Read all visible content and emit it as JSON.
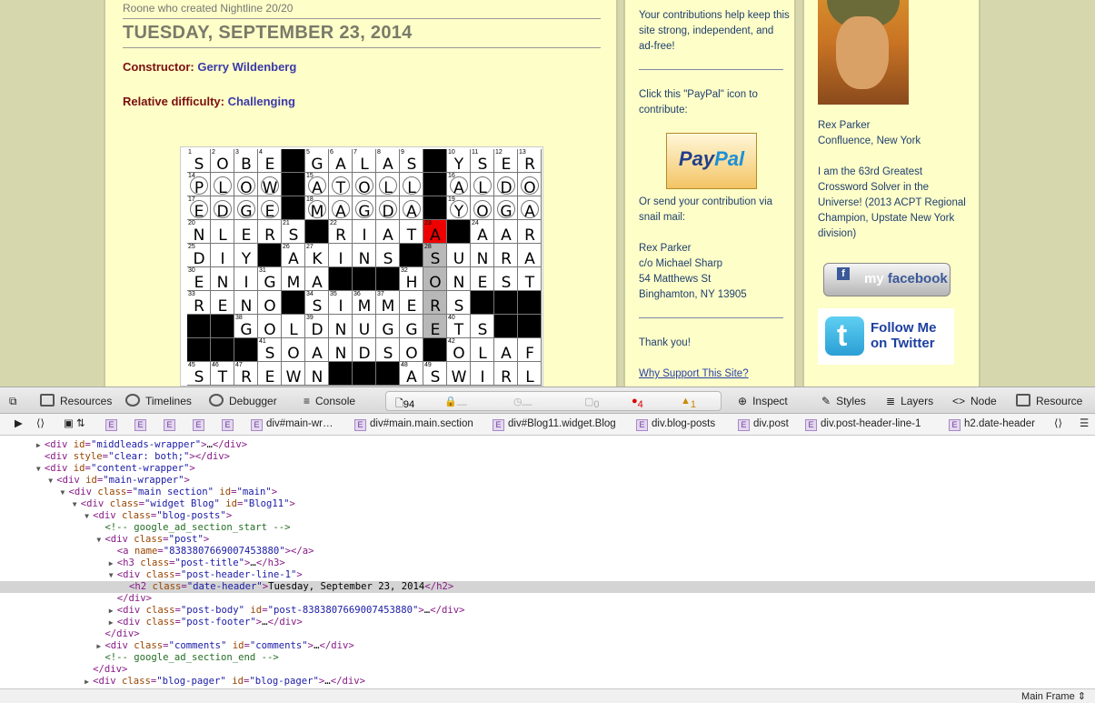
{
  "blog": {
    "prev_post_tail": "Roone who created Nightline 20/20",
    "date_header": "TUESDAY, SEPTEMBER 23, 2014",
    "constructor_label": "Constructor:",
    "constructor_name": "Gerry Wildenberg",
    "difficulty_label": "Relative difficulty:",
    "difficulty_value": "Challenging"
  },
  "crossword": {
    "rows": [
      [
        "S",
        "O",
        "B",
        "E",
        "#",
        "G",
        "A",
        "L",
        "A",
        "S",
        "#",
        "Y",
        "S",
        "E",
        "R"
      ],
      [
        "P",
        "L",
        "O",
        "W",
        "#",
        "A",
        "T",
        "O",
        "L",
        "L",
        "#",
        "A",
        "L",
        "D",
        "O"
      ],
      [
        "E",
        "D",
        "G",
        "E",
        "#",
        "M",
        "A",
        "G",
        "D",
        "A",
        "#",
        "Y",
        "O",
        "G",
        "A"
      ],
      [
        "N",
        "L",
        "E",
        "R",
        "S",
        "#",
        "R",
        "I",
        "A",
        "T",
        "A",
        "#",
        "A",
        "A",
        "R"
      ],
      [
        "D",
        "I",
        "Y",
        "#",
        "A",
        "K",
        "I",
        "N",
        "S",
        "#",
        "S",
        "U",
        "N",
        "R",
        "A"
      ],
      [
        "E",
        "N",
        "I",
        "G",
        "M",
        "A",
        "#",
        "#",
        "#",
        "H",
        "O",
        "N",
        "E",
        "S",
        "T"
      ],
      [
        "R",
        "E",
        "N",
        "O",
        "#",
        "S",
        "I",
        "M",
        "M",
        "E",
        "R",
        "S",
        "#",
        "#",
        "#"
      ],
      [
        "#",
        "#",
        "G",
        "O",
        "L",
        "D",
        "N",
        "U",
        "G",
        "G",
        "E",
        "T",
        "S",
        "#",
        "#"
      ],
      [
        "#",
        "#",
        "#",
        "S",
        "O",
        "A",
        "N",
        "D",
        "S",
        "O",
        "#",
        "O",
        "L",
        "A",
        "F"
      ],
      [
        "S",
        "T",
        "R",
        "E",
        "W",
        "N",
        "#",
        "#",
        "#",
        "A",
        "S",
        "W",
        "I",
        "R",
        "L"
      ]
    ],
    "numbers": [
      [
        1,
        2,
        3,
        4,
        null,
        5,
        6,
        7,
        8,
        9,
        null,
        10,
        11,
        12,
        13
      ],
      [
        14,
        null,
        null,
        null,
        null,
        15,
        null,
        null,
        null,
        null,
        null,
        16,
        null,
        null,
        null
      ],
      [
        17,
        null,
        null,
        null,
        null,
        18,
        null,
        null,
        null,
        null,
        null,
        19,
        null,
        null,
        null
      ],
      [
        20,
        null,
        null,
        null,
        21,
        null,
        22,
        null,
        null,
        null,
        23,
        null,
        24,
        null,
        null
      ],
      [
        25,
        null,
        null,
        null,
        26,
        27,
        null,
        null,
        null,
        null,
        28,
        null,
        null,
        null,
        null
      ],
      [
        30,
        null,
        null,
        31,
        null,
        null,
        null,
        null,
        null,
        32,
        null,
        null,
        null,
        null,
        null
      ],
      [
        33,
        null,
        null,
        null,
        null,
        34,
        35,
        36,
        37,
        null,
        null,
        null,
        null,
        null,
        null
      ],
      [
        null,
        null,
        38,
        null,
        null,
        39,
        null,
        null,
        null,
        null,
        null,
        40,
        null,
        null,
        null
      ],
      [
        null,
        null,
        null,
        41,
        null,
        null,
        null,
        null,
        null,
        null,
        null,
        42,
        null,
        null,
        null
      ],
      [
        45,
        46,
        47,
        null,
        null,
        null,
        null,
        null,
        null,
        48,
        49,
        null,
        null,
        null,
        null
      ]
    ],
    "circled": [
      [
        1,
        0
      ],
      [
        1,
        1
      ],
      [
        1,
        2
      ],
      [
        1,
        3
      ],
      [
        1,
        5
      ],
      [
        1,
        6
      ],
      [
        1,
        7
      ],
      [
        1,
        8
      ],
      [
        1,
        9
      ],
      [
        1,
        11
      ],
      [
        1,
        12
      ],
      [
        1,
        13
      ],
      [
        1,
        14
      ],
      [
        2,
        0
      ],
      [
        2,
        1
      ],
      [
        2,
        2
      ],
      [
        2,
        3
      ],
      [
        2,
        5
      ],
      [
        2,
        6
      ],
      [
        2,
        7
      ],
      [
        2,
        8
      ],
      [
        2,
        9
      ],
      [
        2,
        11
      ],
      [
        2,
        12
      ],
      [
        2,
        13
      ],
      [
        2,
        14
      ]
    ],
    "highlight_red": [
      [
        3,
        10
      ]
    ],
    "highlight_gray": [
      [
        4,
        10
      ],
      [
        5,
        10
      ],
      [
        6,
        10
      ],
      [
        7,
        10
      ]
    ]
  },
  "sidebar_mid": {
    "contrib_text": "Your contributions help keep this site strong, independent, and ad-free!",
    "paypal_prompt": "Click this \"PayPal\" icon to contribute:",
    "paypal_pay": "Pay",
    "paypal_pal": "Pal",
    "snail_text": "Or send your contribution via snail mail:",
    "addr_name": "Rex Parker",
    "addr_co": "c/o Michael Sharp",
    "addr_street": "54 Matthews St",
    "addr_city": "Binghamton, NY 13905",
    "thanks": "Thank you!",
    "why_link": "Why Support This Site?"
  },
  "sidebar_right": {
    "name": "Rex Parker",
    "location": "Confluence, New York",
    "bio": "I am the 63rd Greatest Crossword Solver in the Universe! (2013 ACPT Regional Champion, Upstate New York division)",
    "facebook_my": "my",
    "facebook_word": "facebook",
    "twitter_line1": "Follow Me",
    "twitter_line2": "on Twitter"
  },
  "devtools": {
    "tabs": {
      "resources": "Resources",
      "timelines": "Timelines",
      "debugger": "Debugger",
      "console": "Console",
      "inspect": "Inspect",
      "styles": "Styles",
      "layers": "Layers",
      "node": "Node",
      "resource": "Resource"
    },
    "status": {
      "resources_count": "94",
      "network": "—",
      "time": "—",
      "logs": "0",
      "errors": "4",
      "warnings": "1"
    },
    "crumbs": [
      "div#main-wr…",
      "div#main.main.section",
      "div#Blog11.widget.Blog",
      "div.blog-posts",
      "div.post",
      "div.post-header-line-1",
      "h2.date-header"
    ],
    "crumb_e": "E",
    "frame": "Main Frame",
    "dom_lines": [
      {
        "indent": 3,
        "tri": "▶",
        "parts": [
          [
            "tg",
            "<div "
          ],
          [
            "an",
            "id"
          ],
          [
            "tg",
            "="
          ],
          [
            "av",
            "\"middleads-wrapper\""
          ],
          [
            "tg",
            ">"
          ],
          [
            "tx",
            "…"
          ],
          [
            "tg",
            "</div>"
          ]
        ]
      },
      {
        "indent": 3,
        "tri": "",
        "parts": [
          [
            "tg",
            "<div "
          ],
          [
            "an",
            "style"
          ],
          [
            "tg",
            "="
          ],
          [
            "av",
            "\"clear: both;\""
          ],
          [
            "tg",
            "></div>"
          ]
        ]
      },
      {
        "indent": 3,
        "tri": "▼",
        "parts": [
          [
            "tg",
            "<div "
          ],
          [
            "an",
            "id"
          ],
          [
            "tg",
            "="
          ],
          [
            "av",
            "\"content-wrapper\""
          ],
          [
            "tg",
            ">"
          ]
        ]
      },
      {
        "indent": 4,
        "tri": "▼",
        "parts": [
          [
            "tg",
            "<div "
          ],
          [
            "an",
            "id"
          ],
          [
            "tg",
            "="
          ],
          [
            "av",
            "\"main-wrapper\""
          ],
          [
            "tg",
            ">"
          ]
        ]
      },
      {
        "indent": 5,
        "tri": "▼",
        "parts": [
          [
            "tg",
            "<div "
          ],
          [
            "an",
            "class"
          ],
          [
            "tg",
            "="
          ],
          [
            "av",
            "\"main section\""
          ],
          [
            "tg",
            " "
          ],
          [
            "an",
            "id"
          ],
          [
            "tg",
            "="
          ],
          [
            "av",
            "\"main\""
          ],
          [
            "tg",
            ">"
          ]
        ]
      },
      {
        "indent": 6,
        "tri": "▼",
        "parts": [
          [
            "tg",
            "<div "
          ],
          [
            "an",
            "class"
          ],
          [
            "tg",
            "="
          ],
          [
            "av",
            "\"widget Blog\""
          ],
          [
            "tg",
            " "
          ],
          [
            "an",
            "id"
          ],
          [
            "tg",
            "="
          ],
          [
            "av",
            "\"Blog11\""
          ],
          [
            "tg",
            ">"
          ]
        ]
      },
      {
        "indent": 7,
        "tri": "▼",
        "parts": [
          [
            "tg",
            "<div "
          ],
          [
            "an",
            "class"
          ],
          [
            "tg",
            "="
          ],
          [
            "av",
            "\"blog-posts\""
          ],
          [
            "tg",
            ">"
          ]
        ]
      },
      {
        "indent": 8,
        "tri": "",
        "parts": [
          [
            "cm",
            "<!-- google_ad_section_start -->"
          ]
        ]
      },
      {
        "indent": 8,
        "tri": "▼",
        "parts": [
          [
            "tg",
            "<div "
          ],
          [
            "an",
            "class"
          ],
          [
            "tg",
            "="
          ],
          [
            "av",
            "\"post\""
          ],
          [
            "tg",
            ">"
          ]
        ]
      },
      {
        "indent": 9,
        "tri": "",
        "parts": [
          [
            "tg",
            "<a "
          ],
          [
            "an",
            "name"
          ],
          [
            "tg",
            "="
          ],
          [
            "av",
            "\"8383807669007453880\""
          ],
          [
            "tg",
            "></a>"
          ]
        ]
      },
      {
        "indent": 9,
        "tri": "▶",
        "parts": [
          [
            "tg",
            "<h3 "
          ],
          [
            "an",
            "class"
          ],
          [
            "tg",
            "="
          ],
          [
            "av",
            "\"post-title\""
          ],
          [
            "tg",
            ">"
          ],
          [
            "tx",
            "…"
          ],
          [
            "tg",
            "</h3>"
          ]
        ]
      },
      {
        "indent": 9,
        "tri": "▼",
        "parts": [
          [
            "tg",
            "<div "
          ],
          [
            "an",
            "class"
          ],
          [
            "tg",
            "="
          ],
          [
            "av",
            "\"post-header-line-1\""
          ],
          [
            "tg",
            ">"
          ]
        ]
      },
      {
        "indent": 10,
        "tri": "",
        "sel": true,
        "parts": [
          [
            "tg",
            "<h2 "
          ],
          [
            "an",
            "class"
          ],
          [
            "tg",
            "="
          ],
          [
            "av",
            "\"date-header\""
          ],
          [
            "tg",
            ">"
          ],
          [
            "tx",
            "Tuesday, September 23, 2014"
          ],
          [
            "tg",
            "</h2>"
          ]
        ]
      },
      {
        "indent": 9,
        "tri": "",
        "parts": [
          [
            "tg",
            "</div>"
          ]
        ]
      },
      {
        "indent": 9,
        "tri": "▶",
        "parts": [
          [
            "tg",
            "<div "
          ],
          [
            "an",
            "class"
          ],
          [
            "tg",
            "="
          ],
          [
            "av",
            "\"post-body\""
          ],
          [
            "tg",
            " "
          ],
          [
            "an",
            "id"
          ],
          [
            "tg",
            "="
          ],
          [
            "av",
            "\"post-8383807669007453880\""
          ],
          [
            "tg",
            ">"
          ],
          [
            "tx",
            "…"
          ],
          [
            "tg",
            "</div>"
          ]
        ]
      },
      {
        "indent": 9,
        "tri": "▶",
        "parts": [
          [
            "tg",
            "<div "
          ],
          [
            "an",
            "class"
          ],
          [
            "tg",
            "="
          ],
          [
            "av",
            "\"post-footer\""
          ],
          [
            "tg",
            ">"
          ],
          [
            "tx",
            "…"
          ],
          [
            "tg",
            "</div>"
          ]
        ]
      },
      {
        "indent": 8,
        "tri": "",
        "parts": [
          [
            "tg",
            "</div>"
          ]
        ]
      },
      {
        "indent": 8,
        "tri": "▶",
        "parts": [
          [
            "tg",
            "<div "
          ],
          [
            "an",
            "class"
          ],
          [
            "tg",
            "="
          ],
          [
            "av",
            "\"comments\""
          ],
          [
            "tg",
            " "
          ],
          [
            "an",
            "id"
          ],
          [
            "tg",
            "="
          ],
          [
            "av",
            "\"comments\""
          ],
          [
            "tg",
            ">"
          ],
          [
            "tx",
            "…"
          ],
          [
            "tg",
            "</div>"
          ]
        ]
      },
      {
        "indent": 8,
        "tri": "",
        "parts": [
          [
            "cm",
            "<!-- google_ad_section_end -->"
          ]
        ]
      },
      {
        "indent": 7,
        "tri": "",
        "parts": [
          [
            "tg",
            "</div>"
          ]
        ]
      },
      {
        "indent": 7,
        "tri": "▶",
        "parts": [
          [
            "tg",
            "<div "
          ],
          [
            "an",
            "class"
          ],
          [
            "tg",
            "="
          ],
          [
            "av",
            "\"blog-pager\""
          ],
          [
            "tg",
            " "
          ],
          [
            "an",
            "id"
          ],
          [
            "tg",
            "="
          ],
          [
            "av",
            "\"blog-pager\""
          ],
          [
            "tg",
            ">"
          ],
          [
            "tx",
            "…"
          ],
          [
            "tg",
            "</div>"
          ]
        ]
      }
    ]
  }
}
